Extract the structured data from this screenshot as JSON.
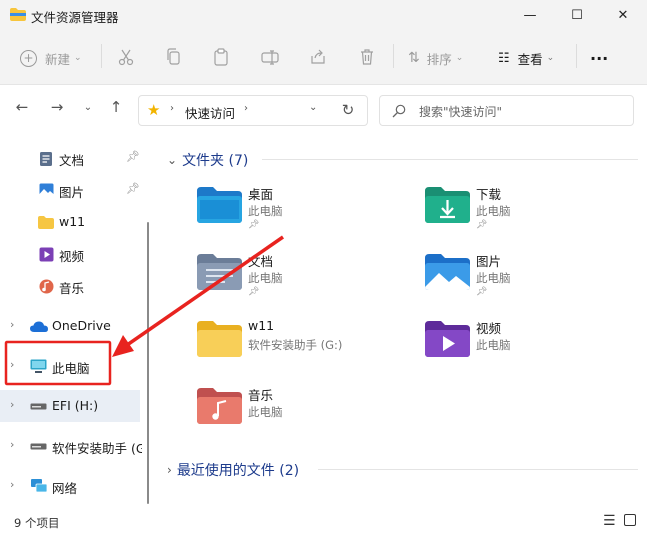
{
  "window": {
    "title": "文件资源管理器",
    "controls": {
      "minimize": "—",
      "maximize": "☐",
      "close": "✕"
    }
  },
  "toolbar": {
    "new_label": "新建",
    "sort_label": "排序",
    "view_label": "查看",
    "more_label": "···"
  },
  "address": {
    "location": "快速访问",
    "search_placeholder": "搜索\"快速访问\""
  },
  "sidebar": {
    "items": [
      {
        "label": "文档",
        "icon": "document-icon",
        "pinned": true
      },
      {
        "label": "图片",
        "icon": "picture-icon",
        "pinned": true
      },
      {
        "label": "w11",
        "icon": "folder-icon",
        "pinned": false
      },
      {
        "label": "视频",
        "icon": "video-icon",
        "pinned": false
      },
      {
        "label": "音乐",
        "icon": "music-icon",
        "pinned": false
      },
      {
        "label": "OneDrive",
        "icon": "cloud-icon",
        "pinned": false
      },
      {
        "label": "此电脑",
        "icon": "computer-icon",
        "pinned": false
      },
      {
        "label": "EFI (H:)",
        "icon": "drive-icon",
        "pinned": false
      },
      {
        "label": "软件安装助手 (G",
        "icon": "drive-icon",
        "pinned": false
      },
      {
        "label": "网络",
        "icon": "network-icon",
        "pinned": false
      }
    ]
  },
  "main": {
    "folders_group": "文件夹 (7)",
    "recent_group": "最近使用的文件 (2)",
    "folders": [
      {
        "name": "桌面",
        "sub": "此电脑",
        "pinned": true,
        "icon": "desktop-folder-icon"
      },
      {
        "name": "下载",
        "sub": "此电脑",
        "pinned": true,
        "icon": "download-folder-icon"
      },
      {
        "name": "文档",
        "sub": "此电脑",
        "pinned": true,
        "icon": "documents-folder-icon"
      },
      {
        "name": "图片",
        "sub": "此电脑",
        "pinned": true,
        "icon": "pictures-folder-icon"
      },
      {
        "name": "w11",
        "sub": "软件安装助手 (G:)",
        "pinned": false,
        "icon": "folder-icon"
      },
      {
        "name": "视频",
        "sub": "此电脑",
        "pinned": false,
        "icon": "videos-folder-icon"
      },
      {
        "name": "音乐",
        "sub": "此电脑",
        "pinned": false,
        "icon": "music-folder-icon"
      }
    ]
  },
  "status": {
    "count": "9 个项目"
  },
  "colors": {
    "accent": "#1d3b8c",
    "annotation": "#e8231f",
    "selected": "#e9eef5"
  }
}
